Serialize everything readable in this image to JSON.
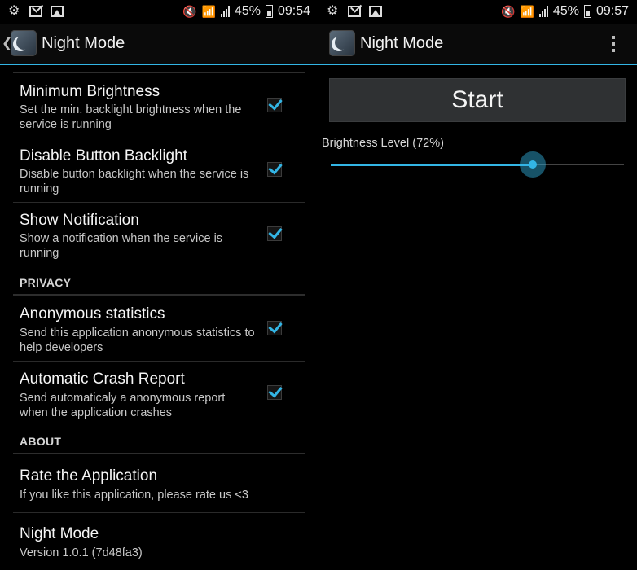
{
  "left": {
    "status": {
      "battery": "45%",
      "time": "09:54"
    },
    "title": "Night Mode",
    "prefs_top": [
      {
        "title": "Minimum Brightness",
        "summary": "Set the min. backlight brightness when the service is running",
        "checked": true
      },
      {
        "title": "Disable Button Backlight",
        "summary": "Disable button backlight when the service is running",
        "checked": true
      },
      {
        "title": "Show Notification",
        "summary": "Show a notification when the service is running",
        "checked": true
      }
    ],
    "section_privacy": "PRIVACY",
    "prefs_privacy": [
      {
        "title": "Anonymous statistics",
        "summary": "Send this application anonymous statistics to help developers",
        "checked": true
      },
      {
        "title": "Automatic Crash Report",
        "summary": "Send automaticaly a anonymous report when the application crashes",
        "checked": true
      }
    ],
    "section_about": "ABOUT",
    "prefs_about": [
      {
        "title": "Rate the Application",
        "summary": "If you like this application, please rate us <3"
      },
      {
        "title": "Night Mode",
        "summary": "Version 1.0.1 (7d48fa3)"
      }
    ]
  },
  "right": {
    "status": {
      "battery": "45%",
      "time": "09:57"
    },
    "title": "Night Mode",
    "start_label": "Start",
    "brightness_label": "Brightness Level",
    "brightness_value_text": "(72%)",
    "brightness_fraction": 0.69
  },
  "colors": {
    "accent": "#33b5e5"
  }
}
